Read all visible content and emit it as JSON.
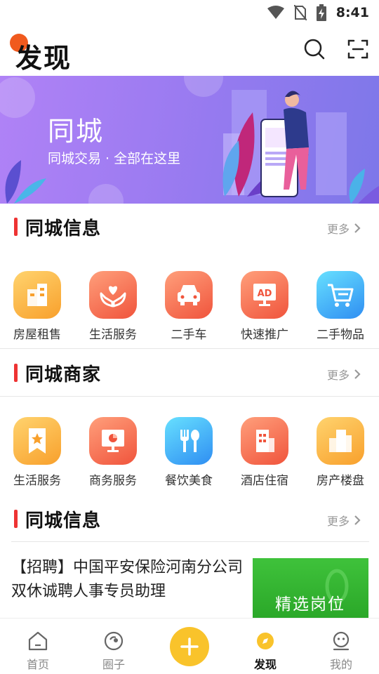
{
  "status": {
    "time": "8:41"
  },
  "header": {
    "title": "发现"
  },
  "banner": {
    "title": "同城",
    "subtitle": "同城交易 · 全部在这里"
  },
  "sections": [
    {
      "title": "同城信息",
      "more": "更多",
      "items": [
        {
          "label": "房屋租售",
          "icon": "building-icon"
        },
        {
          "label": "生活服务",
          "icon": "heart-hands-icon"
        },
        {
          "label": "二手车",
          "icon": "car-icon"
        },
        {
          "label": "快速推广",
          "icon": "ad-icon"
        },
        {
          "label": "二手物品",
          "icon": "cart-icon"
        }
      ]
    },
    {
      "title": "同城商家",
      "more": "更多",
      "items": [
        {
          "label": "生活服务",
          "icon": "bookmark-star-icon"
        },
        {
          "label": "商务服务",
          "icon": "presentation-icon"
        },
        {
          "label": "餐饮美食",
          "icon": "cutlery-icon"
        },
        {
          "label": "酒店住宿",
          "icon": "hotel-icon"
        },
        {
          "label": "房产楼盘",
          "icon": "buildings-icon"
        }
      ]
    },
    {
      "title": "同城信息",
      "more": "更多"
    }
  ],
  "article": {
    "text": "【招聘】中国平安保险河南分公司双休诚聘人事专员助理",
    "image_label": "精选岗位"
  },
  "tabbar": {
    "items": [
      {
        "label": "首页",
        "icon": "home-icon"
      },
      {
        "label": "圈子",
        "icon": "circle-icon"
      },
      {
        "label": "",
        "icon": "plus-icon"
      },
      {
        "label": "发现",
        "icon": "discover-icon",
        "active": true
      },
      {
        "label": "我的",
        "icon": "profile-icon"
      }
    ]
  },
  "colors": {
    "accent": "#f9c32b",
    "section_bar": "#e33333",
    "banner_start": "#b082f6",
    "banner_end": "#7d77e9"
  }
}
